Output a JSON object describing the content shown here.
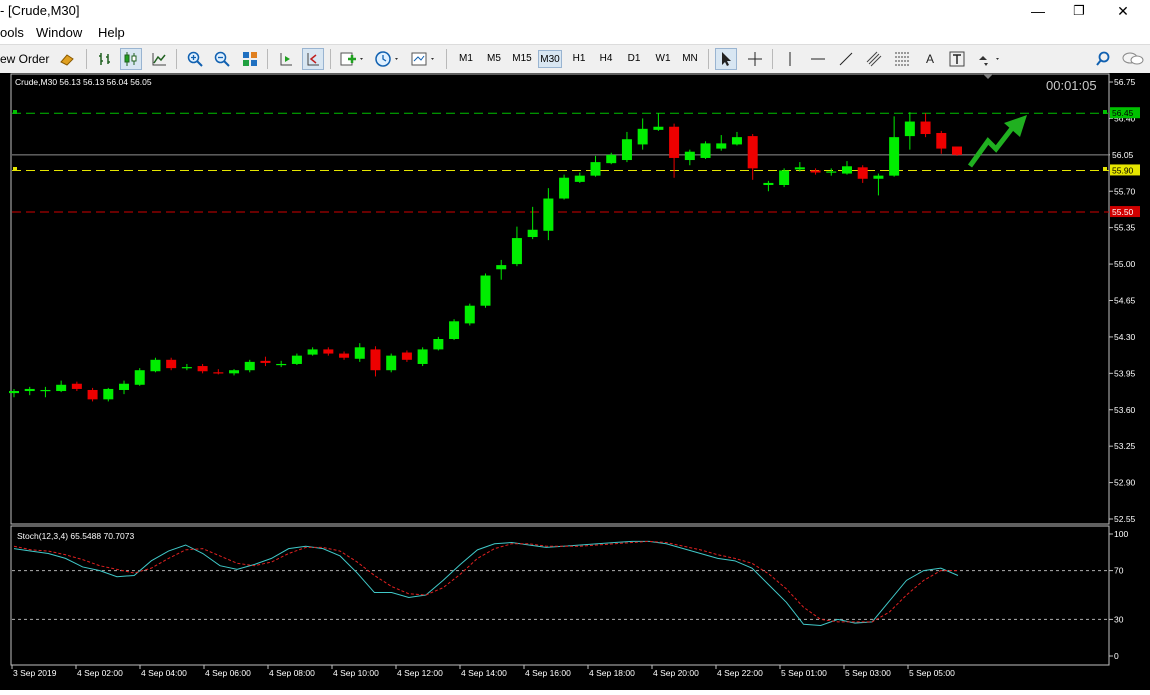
{
  "window": {
    "title": "- [Crude,M30]",
    "minimize": "—",
    "restore": "❐",
    "close": "✕"
  },
  "menu": {
    "items": [
      "ools",
      "Window",
      "Help"
    ]
  },
  "toolbar": {
    "new_order_label": "ew Order",
    "timeframes": [
      "M1",
      "M5",
      "M15",
      "M30",
      "H1",
      "H4",
      "D1",
      "W1",
      "MN"
    ],
    "active_timeframe": "M30"
  },
  "chart": {
    "header": "Crude,M30  56.13 56.13 56.04 56.05",
    "timer": "00:01:05",
    "price_ticks": [
      "56.75",
      "56.40",
      "56.05",
      "55.70",
      "55.35",
      "55.00",
      "54.65",
      "54.30",
      "53.95",
      "53.60",
      "53.25",
      "52.90",
      "52.55"
    ],
    "level_labels": {
      "green": "56.45",
      "current": "56.05",
      "yellow": "55.90",
      "red": "55.50"
    },
    "time_labels": [
      "3 Sep 2019",
      "4 Sep 02:00",
      "4 Sep 04:00",
      "4 Sep 06:00",
      "4 Sep 08:00",
      "4 Sep 10:00",
      "4 Sep 12:00",
      "4 Sep 14:00",
      "4 Sep 16:00",
      "4 Sep 18:00",
      "4 Sep 20:00",
      "4 Sep 22:00",
      "5 Sep 01:00",
      "5 Sep 03:00",
      "5 Sep 05:00"
    ],
    "colors": {
      "bull": "#00ee00",
      "bear": "#ee0000",
      "background": "#000000",
      "green_level": "#00c000",
      "yellow_level": "#e6e600",
      "red_level": "#d00000"
    }
  },
  "indicator": {
    "header": "Stoch(12,3,4) 65.5488 70.7073",
    "ticks": [
      "100",
      "70",
      "30",
      "0"
    ]
  },
  "chart_data": {
    "type": "candlestick",
    "symbol": "Crude",
    "timeframe": "M30",
    "ylim": [
      52.5,
      56.8
    ],
    "ohlc": [
      {
        "o": 53.76,
        "h": 53.8,
        "l": 53.72,
        "c": 53.78
      },
      {
        "o": 53.78,
        "h": 53.82,
        "l": 53.74,
        "c": 53.8
      },
      {
        "o": 53.78,
        "h": 53.82,
        "l": 53.72,
        "c": 53.79
      },
      {
        "o": 53.78,
        "h": 53.88,
        "l": 53.77,
        "c": 53.84
      },
      {
        "o": 53.85,
        "h": 53.87,
        "l": 53.78,
        "c": 53.8
      },
      {
        "o": 53.79,
        "h": 53.81,
        "l": 53.68,
        "c": 53.7
      },
      {
        "o": 53.7,
        "h": 53.81,
        "l": 53.68,
        "c": 53.8
      },
      {
        "o": 53.79,
        "h": 53.88,
        "l": 53.75,
        "c": 53.85
      },
      {
        "o": 53.84,
        "h": 54.0,
        "l": 53.83,
        "c": 53.98
      },
      {
        "o": 53.97,
        "h": 54.1,
        "l": 53.96,
        "c": 54.08
      },
      {
        "o": 54.08,
        "h": 54.1,
        "l": 53.98,
        "c": 54.0
      },
      {
        "o": 54.0,
        "h": 54.04,
        "l": 53.98,
        "c": 54.01
      },
      {
        "o": 54.02,
        "h": 54.04,
        "l": 53.95,
        "c": 53.97
      },
      {
        "o": 53.96,
        "h": 53.99,
        "l": 53.94,
        "c": 53.95
      },
      {
        "o": 53.95,
        "h": 53.99,
        "l": 53.93,
        "c": 53.98
      },
      {
        "o": 53.98,
        "h": 54.08,
        "l": 53.96,
        "c": 54.06
      },
      {
        "o": 54.07,
        "h": 54.11,
        "l": 54.02,
        "c": 54.05
      },
      {
        "o": 54.04,
        "h": 54.07,
        "l": 54.01,
        "c": 54.04
      },
      {
        "o": 54.04,
        "h": 54.14,
        "l": 54.03,
        "c": 54.12
      },
      {
        "o": 54.13,
        "h": 54.2,
        "l": 54.12,
        "c": 54.18
      },
      {
        "o": 54.18,
        "h": 54.2,
        "l": 54.12,
        "c": 54.14
      },
      {
        "o": 54.14,
        "h": 54.16,
        "l": 54.08,
        "c": 54.1
      },
      {
        "o": 54.09,
        "h": 54.24,
        "l": 54.06,
        "c": 54.2
      },
      {
        "o": 54.18,
        "h": 54.21,
        "l": 53.92,
        "c": 53.98
      },
      {
        "o": 53.98,
        "h": 54.14,
        "l": 53.96,
        "c": 54.12
      },
      {
        "o": 54.15,
        "h": 54.17,
        "l": 54.06,
        "c": 54.08
      },
      {
        "o": 54.04,
        "h": 54.2,
        "l": 54.02,
        "c": 54.18
      },
      {
        "o": 54.18,
        "h": 54.3,
        "l": 54.17,
        "c": 54.28
      },
      {
        "o": 54.28,
        "h": 54.47,
        "l": 54.27,
        "c": 54.45
      },
      {
        "o": 54.43,
        "h": 54.62,
        "l": 54.41,
        "c": 54.6
      },
      {
        "o": 54.6,
        "h": 54.91,
        "l": 54.58,
        "c": 54.89
      },
      {
        "o": 54.95,
        "h": 55.04,
        "l": 54.85,
        "c": 54.99
      },
      {
        "o": 55.0,
        "h": 55.36,
        "l": 54.98,
        "c": 55.25
      },
      {
        "o": 55.26,
        "h": 55.55,
        "l": 55.24,
        "c": 55.33
      },
      {
        "o": 55.32,
        "h": 55.73,
        "l": 55.23,
        "c": 55.63
      },
      {
        "o": 55.63,
        "h": 55.86,
        "l": 55.62,
        "c": 55.83
      },
      {
        "o": 55.79,
        "h": 55.88,
        "l": 55.78,
        "c": 55.85
      },
      {
        "o": 55.85,
        "h": 56.04,
        "l": 55.84,
        "c": 55.98
      },
      {
        "o": 55.97,
        "h": 56.07,
        "l": 55.96,
        "c": 56.05
      },
      {
        "o": 56.0,
        "h": 56.27,
        "l": 55.98,
        "c": 56.2
      },
      {
        "o": 56.15,
        "h": 56.4,
        "l": 56.1,
        "c": 56.3
      },
      {
        "o": 56.29,
        "h": 56.45,
        "l": 56.28,
        "c": 56.32
      },
      {
        "o": 56.32,
        "h": 56.35,
        "l": 55.83,
        "c": 56.02
      },
      {
        "o": 56.0,
        "h": 56.1,
        "l": 55.95,
        "c": 56.08
      },
      {
        "o": 56.02,
        "h": 56.18,
        "l": 56.01,
        "c": 56.16
      },
      {
        "o": 56.11,
        "h": 56.24,
        "l": 56.09,
        "c": 56.16
      },
      {
        "o": 56.15,
        "h": 56.27,
        "l": 56.14,
        "c": 56.22
      },
      {
        "o": 56.23,
        "h": 56.25,
        "l": 55.81,
        "c": 55.92
      },
      {
        "o": 55.76,
        "h": 55.8,
        "l": 55.7,
        "c": 55.78
      },
      {
        "o": 55.76,
        "h": 55.92,
        "l": 55.74,
        "c": 55.9
      },
      {
        "o": 55.91,
        "h": 55.98,
        "l": 55.89,
        "c": 55.93
      },
      {
        "o": 55.9,
        "h": 55.92,
        "l": 55.86,
        "c": 55.88
      },
      {
        "o": 55.88,
        "h": 55.92,
        "l": 55.85,
        "c": 55.89
      },
      {
        "o": 55.87,
        "h": 55.99,
        "l": 55.86,
        "c": 55.94
      },
      {
        "o": 55.93,
        "h": 55.95,
        "l": 55.78,
        "c": 55.82
      },
      {
        "o": 55.82,
        "h": 55.87,
        "l": 55.66,
        "c": 55.85
      },
      {
        "o": 55.85,
        "h": 56.42,
        "l": 55.84,
        "c": 56.22
      },
      {
        "o": 56.23,
        "h": 56.46,
        "l": 56.1,
        "c": 56.37
      },
      {
        "o": 56.37,
        "h": 56.45,
        "l": 56.22,
        "c": 56.25
      },
      {
        "o": 56.26,
        "h": 56.28,
        "l": 56.06,
        "c": 56.11
      },
      {
        "o": 56.13,
        "h": 56.13,
        "l": 56.04,
        "c": 56.05
      }
    ],
    "levels": [
      {
        "price": 56.45,
        "color": "green",
        "style": "dashed"
      },
      {
        "price": 55.9,
        "color": "yellow",
        "style": "dashed"
      },
      {
        "price": 55.5,
        "color": "red",
        "style": "dashed"
      },
      {
        "price": 56.05,
        "color": "gray",
        "style": "solid"
      }
    ],
    "stochastic": {
      "params": "12,3,4",
      "ylim": [
        0,
        100
      ],
      "levels": [
        30,
        70
      ],
      "main_last": 65.5488,
      "signal_last": 70.7073
    }
  }
}
